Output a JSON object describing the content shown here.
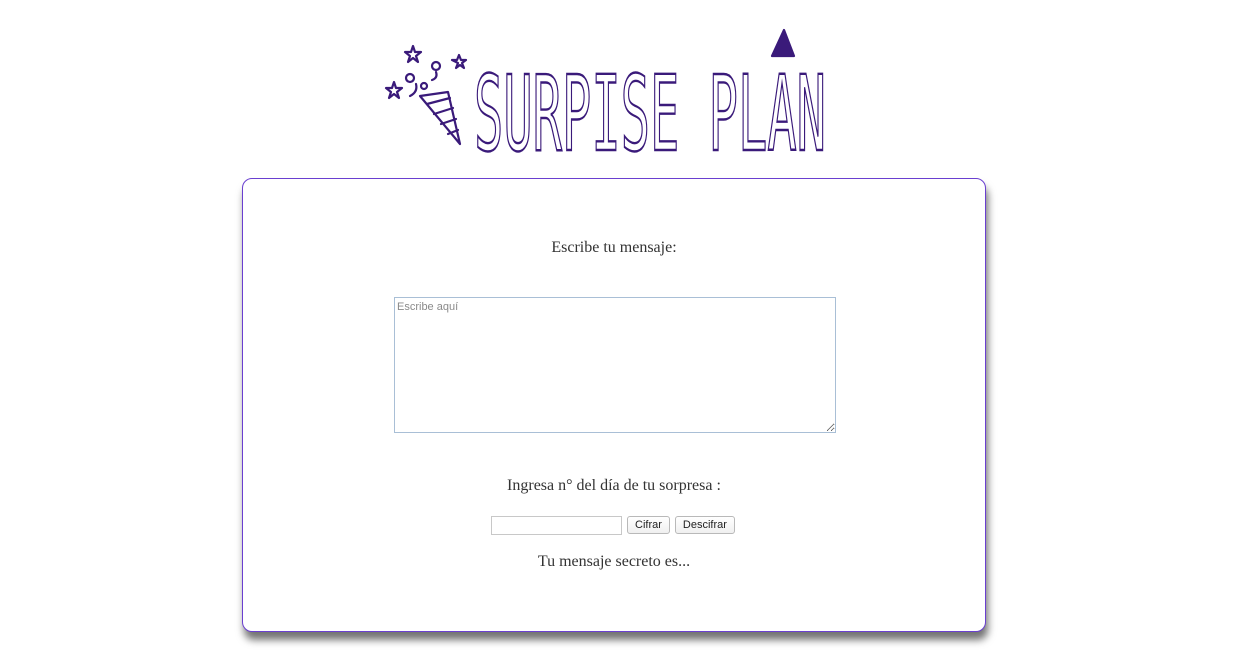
{
  "header": {
    "logo_text": "SURPISE PLAN",
    "logo_color": "#3a1a7a"
  },
  "form": {
    "message_label": "Escribe tu mensaje:",
    "message_placeholder": "Escribe aquí",
    "message_value": "",
    "day_label": "Ingresa n° del día de tu sorpresa :",
    "day_value": "",
    "encrypt_button": "Cifrar",
    "decrypt_button": "Descifrar",
    "result_label": "Tu mensaje secreto es..."
  },
  "colors": {
    "card_border": "#6a3fd0",
    "textarea_border": "#a9bfd6"
  }
}
